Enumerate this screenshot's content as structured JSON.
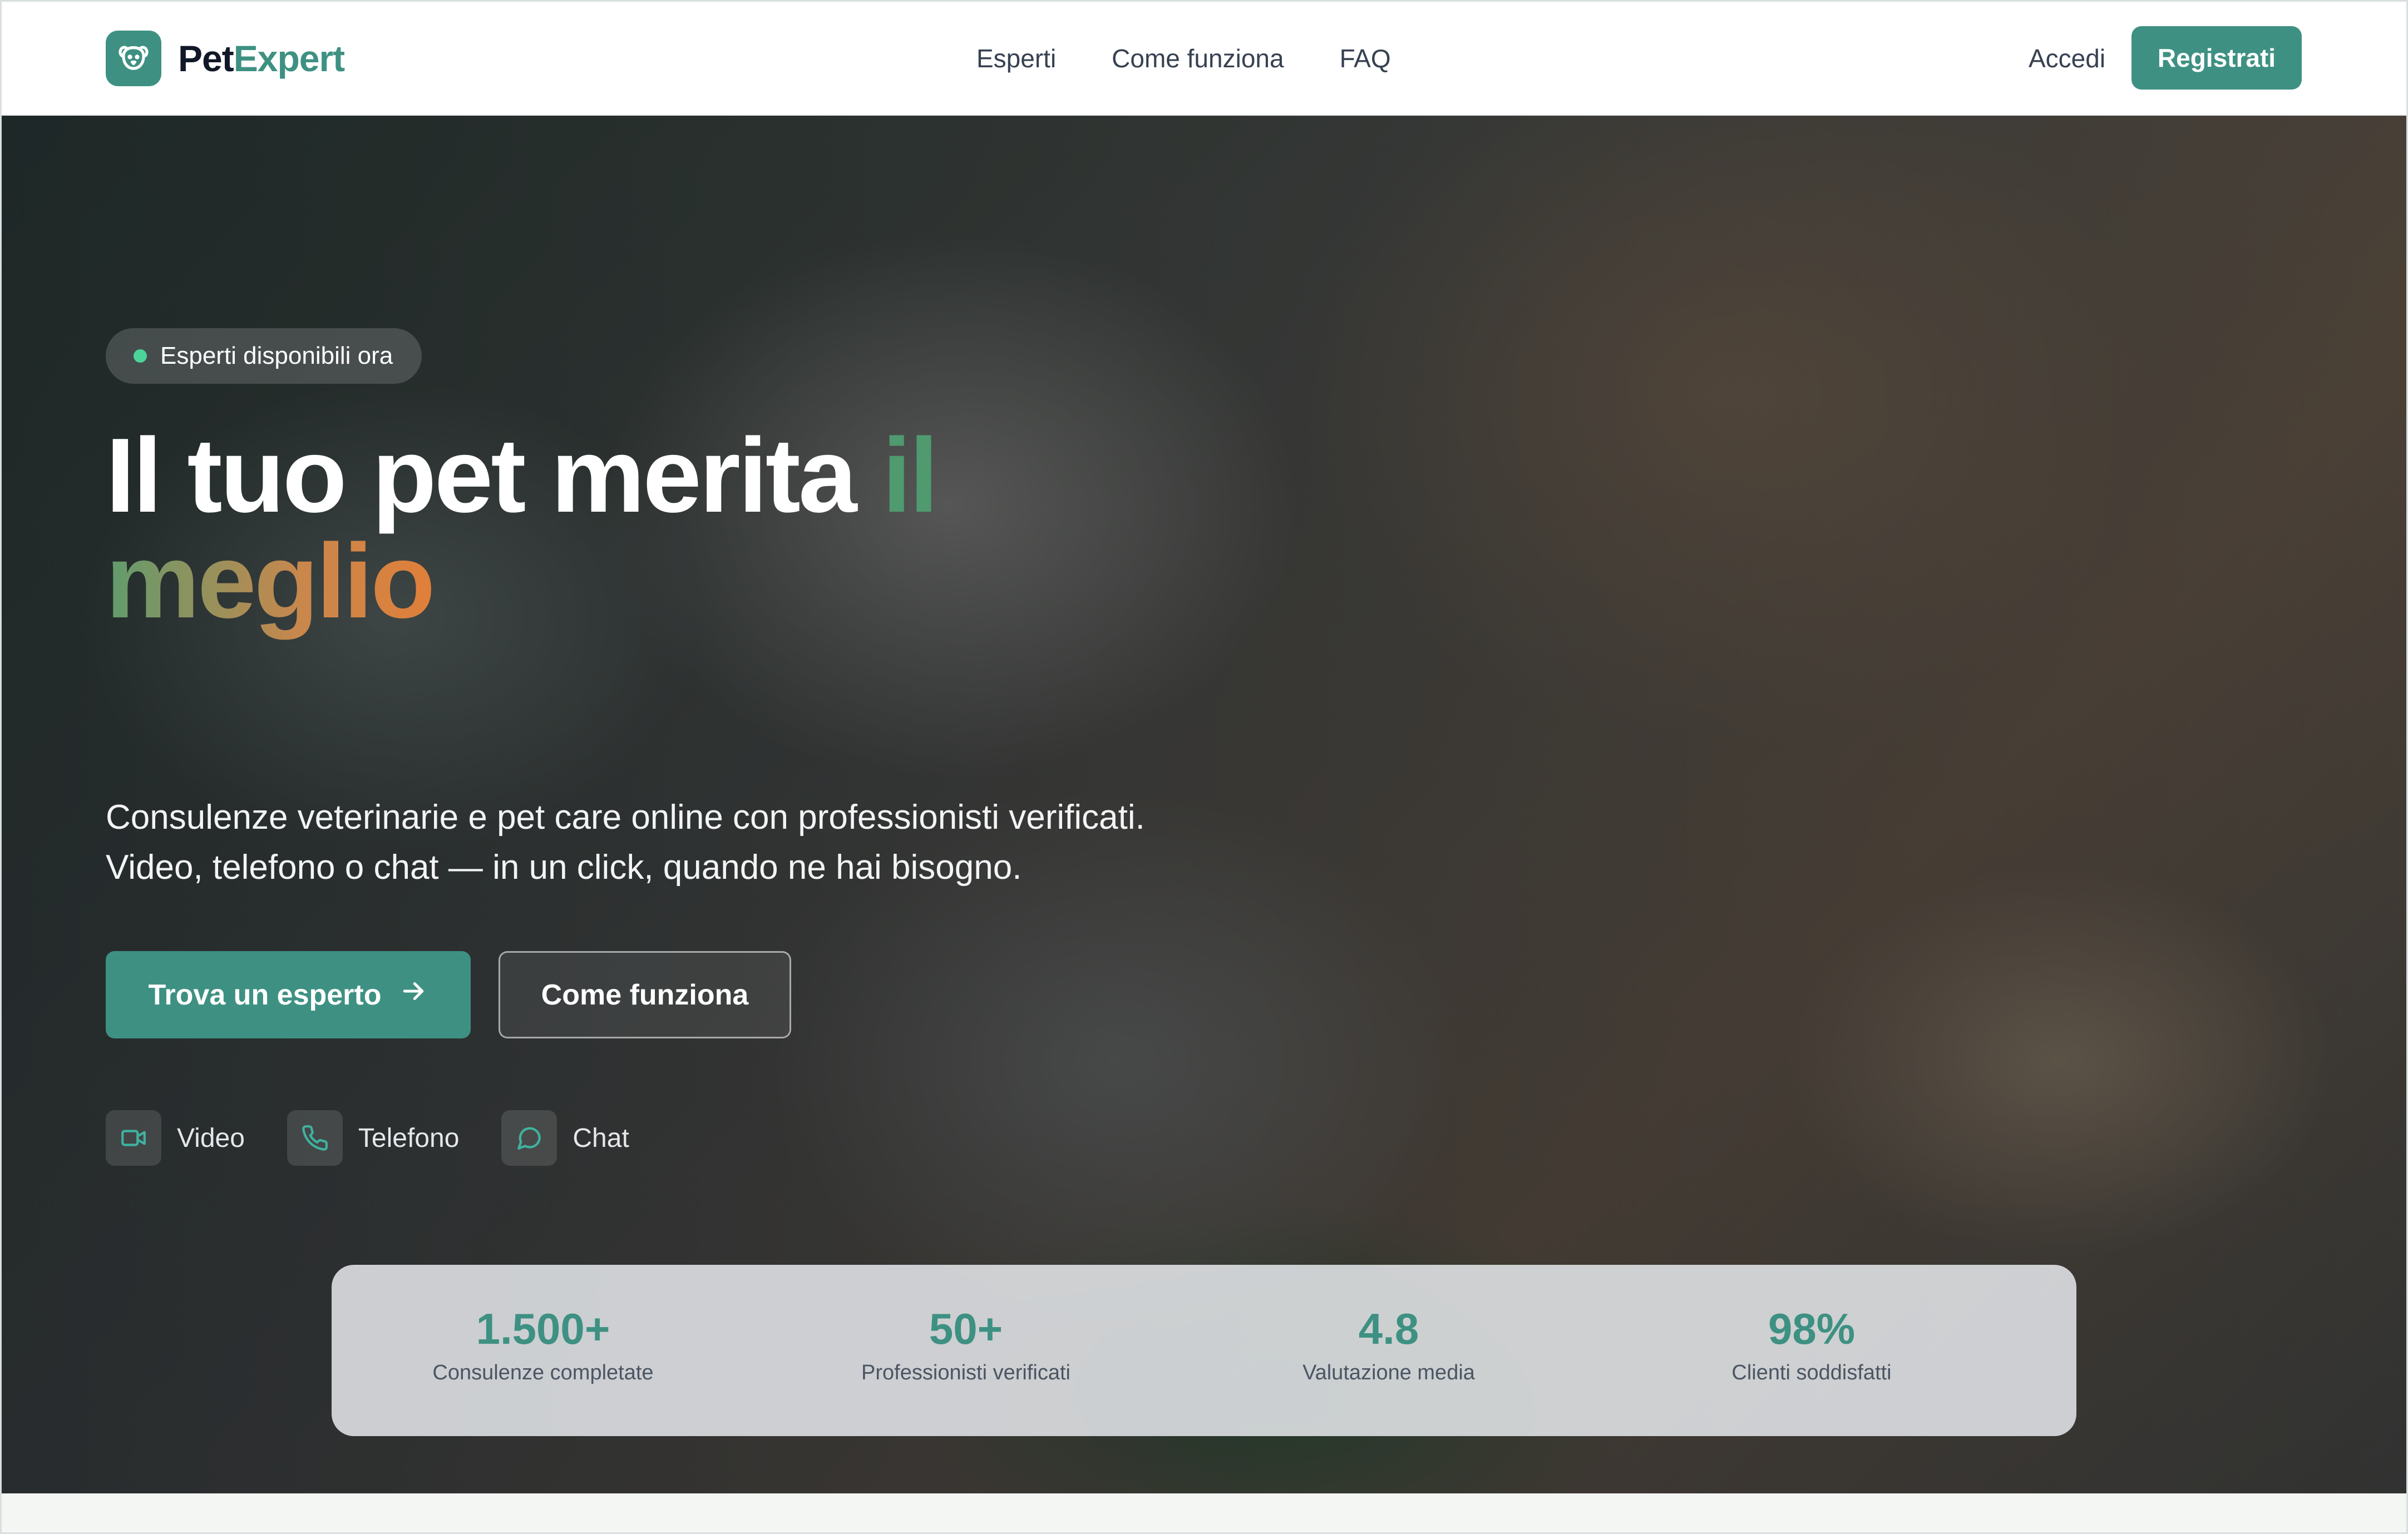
{
  "nav": {
    "logo_part1": "Pet",
    "logo_part2": "Expert",
    "links": [
      "Esperti",
      "Come funziona",
      "FAQ"
    ],
    "login": "Accedi",
    "register": "Registrati"
  },
  "hero": {
    "badge": "Esperti disponibili ora",
    "headline_white": "Il tuo pet merita ",
    "headline_green": "il",
    "headline_gradient": "meglio",
    "subtitle_line1": "Consulenze veterinarie e pet care online con professionisti verificati.",
    "subtitle_line2": "Video, telefono o chat — in un click, quando ne hai bisogno.",
    "primary_button": "Trova un esperto",
    "secondary_button": "Come funziona",
    "modes": [
      {
        "icon": "video-icon",
        "label": "Video"
      },
      {
        "icon": "phone-icon",
        "label": "Telefono"
      },
      {
        "icon": "chat-icon",
        "label": "Chat"
      }
    ]
  },
  "stats": [
    {
      "value": "1.500+",
      "label": "Consulenze completate"
    },
    {
      "value": "50+",
      "label": "Professionisti verificati"
    },
    {
      "value": "4.8",
      "label": "Valutazione media"
    },
    {
      "value": "98%",
      "label": "Clienti soddisfatti"
    }
  ],
  "colors": {
    "brand": "#3e9182",
    "badge_dot": "#4cd39a",
    "gradient_start": "#5f9c6d",
    "gradient_end": "#e07f3a"
  }
}
